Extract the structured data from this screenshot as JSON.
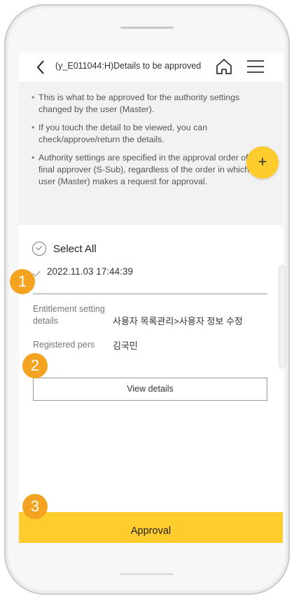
{
  "header": {
    "title": "(y_E011044:H)Details to be approved",
    "back_icon": "chevron-left-icon",
    "home_icon": "home-icon",
    "menu_icon": "hamburger-menu-icon"
  },
  "notice": {
    "items": [
      "This is what to be approved for the authority settings changed by the user (Master).",
      "If you touch the detail to be viewed, you can check/approve/return the details.",
      "Authority settings are specified in the approval order of the final approver (S-Sub), regardless of the order in which the user (Master) makes a request for approval."
    ]
  },
  "fab": {
    "label": "+"
  },
  "select_all": {
    "label": "Select All"
  },
  "item": {
    "datetime": "2022.11.03 17:44:39",
    "entitlement_label": "Entitlement setting details",
    "entitlement_value": "사용자 목록관리>사용자 정보 수정",
    "registered_label": "Registered pers",
    "registered_value": "김국민",
    "view_details_label": "View details"
  },
  "approval": {
    "label": "Approval"
  },
  "badges": [
    "1",
    "2",
    "3"
  ],
  "colors": {
    "accent": "#ffcc2e",
    "badge": "#f4a321"
  }
}
